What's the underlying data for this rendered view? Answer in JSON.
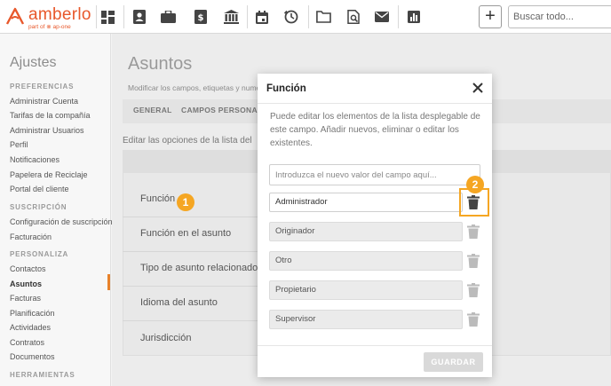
{
  "brand": {
    "name": "amberlo",
    "sub": "part of ⊗ ap-one",
    "color": "#e8582b"
  },
  "topbar": {
    "icons": [
      "dashboard-icon",
      "contacts-icon",
      "briefcase-icon",
      "billing-icon",
      "bank-icon",
      "calendar-icon",
      "timer-icon",
      "folder-icon",
      "document-search-icon",
      "mail-icon",
      "reports-icon"
    ],
    "add_label": "+",
    "search_placeholder": "Buscar todo..."
  },
  "sidebar": {
    "title": "Ajustes",
    "sections": [
      {
        "heading": "PREFERENCIAS",
        "items": [
          "Administrar Cuenta",
          "Tarifas de la compañía",
          "Administrar Usuarios",
          "Perfil",
          "Notificaciones",
          "Papelera de Reciclaje",
          "Portal del cliente"
        ]
      },
      {
        "heading": "SUSCRIPCIÓN",
        "items": [
          "Configuración de suscripción",
          "Facturación"
        ]
      },
      {
        "heading": "PERSONALIZA",
        "items": [
          "Contactos",
          "Asuntos",
          "Facturas",
          "Planificación",
          "Actividades",
          "Contratos",
          "Documentos"
        ]
      },
      {
        "heading": "HERRAMIENTAS",
        "items": []
      }
    ],
    "active_item": "Asuntos",
    "accent": "#e8822b"
  },
  "page": {
    "title": "Asuntos",
    "subtitle": "Modificar los campos, etiquetas y numer",
    "tabs": [
      "GENERAL",
      "CAMPOS PERSONALI"
    ],
    "edit_text": "Editar las opciones de la lista del",
    "rows": [
      "Función",
      "Función en el asunto",
      "Tipo de asunto relacionado",
      "Idioma del asunto",
      "Jurisdicción"
    ]
  },
  "badges": {
    "one": "1",
    "two": "2",
    "color": "#f5a623"
  },
  "modal": {
    "title": "Función",
    "description": "Puede editar los elementos de la lista desplegable de este campo. Añadir nuevos, eliminar o editar los existentes.",
    "new_value_placeholder": "Introduzca el nuevo valor del campo aquí...",
    "values": [
      "Administrador",
      "Originador",
      "Otro",
      "Propietario",
      "Supervisor"
    ],
    "save_label": "GUARDAR"
  }
}
